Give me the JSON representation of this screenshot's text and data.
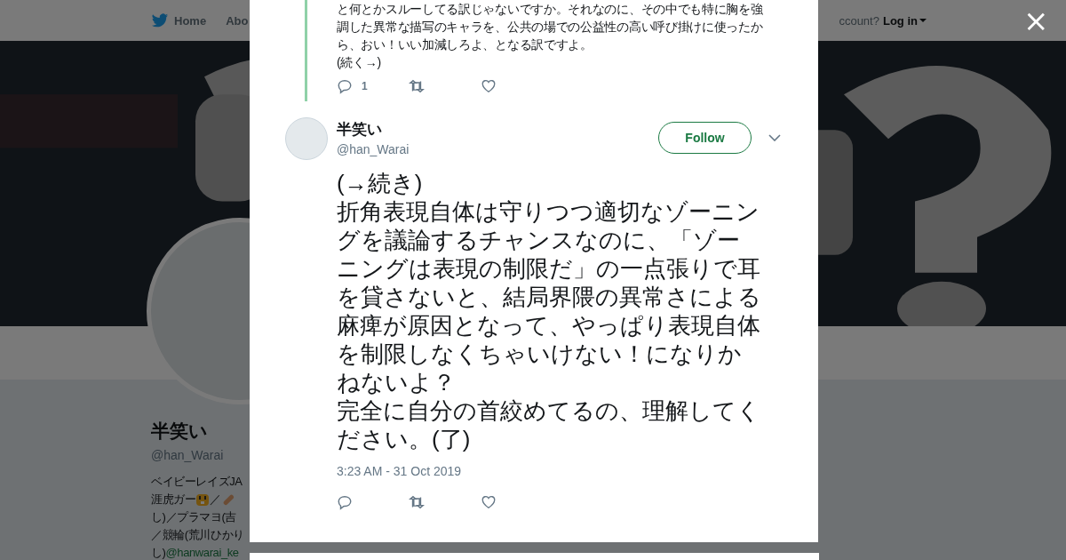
{
  "background_page": {
    "nav": [
      {
        "label": "Home",
        "kind": "home"
      },
      {
        "label": "Abo",
        "kind": "text"
      }
    ],
    "account_prompt": "ccount?",
    "login": "Log in",
    "profile": {
      "name": "半笑い",
      "handle": "@han_Warai",
      "bio_lines": [
        [
          {
            "kind": "text",
            "text": "ベイビーレイズJA"
          }
        ],
        [
          {
            "kind": "text",
            "text": "涯虎ガー"
          },
          {
            "kind": "tiger"
          },
          {
            "kind": "text",
            "text": "／"
          },
          {
            "kind": "bandage"
          }
        ],
        [
          {
            "kind": "text",
            "text": "し)／プラマヨ(吉"
          }
        ],
        [
          {
            "kind": "text",
            "text": "／競輪(荒川ひかり"
          }
        ],
        [
          {
            "kind": "text",
            "text": "し)"
          },
          {
            "kind": "link",
            "text": "@hanwarai_ke"
          }
        ]
      ]
    }
  },
  "modal": {
    "previous_tweet": {
      "text_lines": [
        "と何とかスルーしてる訳じゃないですか。それなのに、その中でも特に胸を強",
        "調した異常な描写のキャラを、公共の場での公益性の高い呼び掛けに使ったか",
        "ら、おい！いい加減しろよ、となる訳ですよ。",
        "(続く→)"
      ],
      "reply_count": "1"
    },
    "tweet": {
      "name": "半笑い",
      "handle": "@han_Warai",
      "follow_button": "Follow",
      "paragraphs": [
        "(→続き)",
        "折角表現自体は守りつつ適切なゾーニングを議論するチャンスなのに、「ゾーニングは表現の制限だ」の一点張りで耳を貸さないと、結局界隈の異常さによる麻痺が原因となって、やっぱり表現自体を制限しなくちゃいけない！になりかねないよ？",
        "完全に自分の首絞めてるの、理解してください。(了)"
      ],
      "timestamp": "3:23 AM - 31 Oct 2019"
    }
  },
  "close_button": "×"
}
